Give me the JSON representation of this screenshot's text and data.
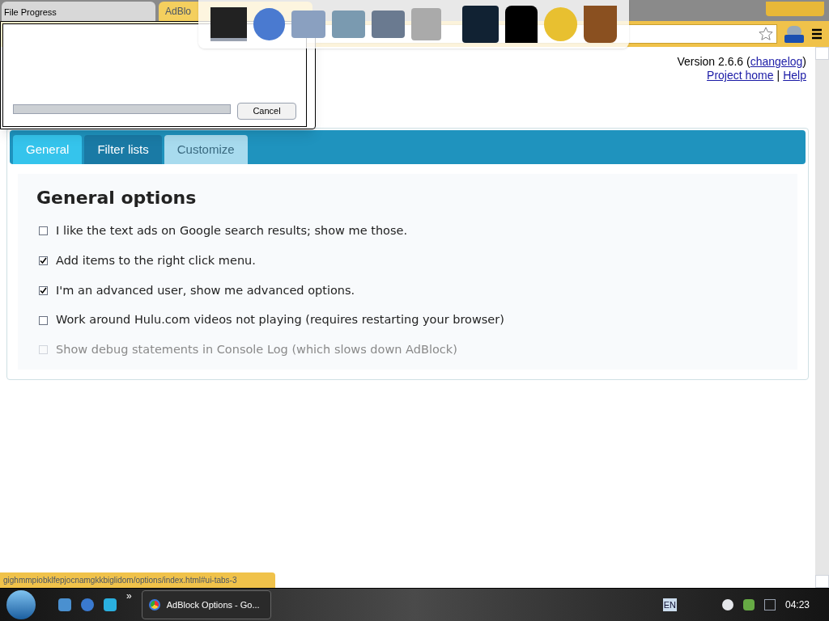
{
  "browser": {
    "tabs": [
      {
        "selected": false
      },
      {
        "label": "AdBlo",
        "selected": true
      }
    ]
  },
  "header": {
    "version": "Version 2.6.6 (",
    "changelog": "changelog",
    "version_end": ")",
    "links": [
      "Project home",
      "Help"
    ],
    "separator": "|"
  },
  "tabs": [
    {
      "label": "General",
      "selected": true
    },
    {
      "label": "Filter lists",
      "selected": false
    },
    {
      "label": "Customize",
      "selected": false
    }
  ],
  "section": {
    "title": "General options",
    "options": [
      {
        "label": "I like the text ads on Google search results; show me those.",
        "checked": false,
        "disabled": false
      },
      {
        "label": "Add items to the right click menu.",
        "checked": true,
        "disabled": false
      },
      {
        "label": "I'm an advanced user, show me advanced options.",
        "checked": true,
        "disabled": false
      },
      {
        "label": "Work around Hulu.com videos not playing (requires restarting your browser)",
        "checked": false,
        "disabled": false
      },
      {
        "label": "Show debug statements in Console Log (which slows down AdBlock)",
        "checked": false,
        "disabled": true
      }
    ]
  },
  "status_bar": "gighmmpiobklfepjocnamgkkbiglidom/options/index.html#ui-tabs-3",
  "dialog": {
    "title": "File Progress",
    "level": 0,
    "button": "Cancel"
  },
  "taskbar": {
    "overflow": "»",
    "window": "AdBlock Options - Go...",
    "language": "EN",
    "time": "04:23"
  }
}
